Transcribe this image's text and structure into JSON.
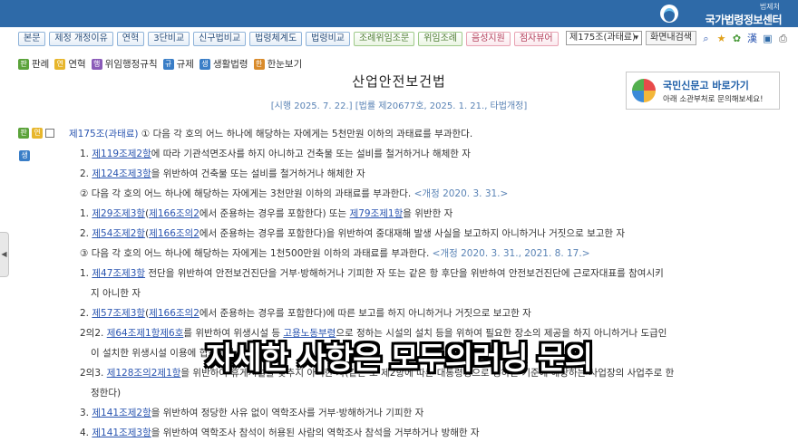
{
  "brand": {
    "org": "법제처",
    "name": "국가법령정보센터"
  },
  "toolbar": [
    {
      "label": "본문",
      "tone": "blue"
    },
    {
      "label": "제정 개정이유",
      "tone": "blue"
    },
    {
      "label": "연혁",
      "tone": "blue"
    },
    {
      "label": "3단비교",
      "tone": "blue"
    },
    {
      "label": "신구법비교",
      "tone": "blue"
    },
    {
      "label": "법령체계도",
      "tone": "blue"
    },
    {
      "label": "법령비교",
      "tone": "blue"
    },
    {
      "label": "조례위임조문",
      "tone": "green"
    },
    {
      "label": "위임조례",
      "tone": "green"
    },
    {
      "label": "음성지원",
      "tone": "pink"
    },
    {
      "label": "점자뷰어",
      "tone": "pink"
    }
  ],
  "tools": {
    "article_select": "제175조(과태료)",
    "wide_view": "화면내검색",
    "icons": [
      "search-icon",
      "bookmark-icon",
      "leaf-icon",
      "translate-icon",
      "save-icon",
      "print-icon"
    ]
  },
  "legend": [
    {
      "tag": "판",
      "label": "판례",
      "color": "#5ba33b"
    },
    {
      "tag": "연",
      "label": "연혁",
      "color": "#e7b62c"
    },
    {
      "tag": "행",
      "label": "위임행정규칙",
      "color": "#8a5ab8"
    },
    {
      "tag": "규",
      "label": "규제",
      "color": "#3a7ec7"
    },
    {
      "tag": "생",
      "label": "생활법령",
      "color": "#3a7ec7"
    },
    {
      "tag": "한",
      "label": "한눈보기",
      "color": "#d98b2b"
    }
  ],
  "law": {
    "title": "산업안전보건법",
    "meta": "[시행 2025. 7. 22.] [법률 제20677호, 2025. 1. 21., 타법개정]"
  },
  "banner": {
    "title": "국민신문고 바로가기",
    "subtitle": "아래 소관부처로 문의해보세요!"
  },
  "side_tags": [
    "판",
    "연"
  ],
  "side_tag_extra": "생",
  "article": {
    "head": "제175조(과태료)",
    "p1": "① 다음 각 호의 어느 하나에 해당하는 자에게는 5천만원 이하의 과태료를 부과한다.",
    "p1_items": [
      {
        "num": "1.",
        "link": "제119조제2항",
        "rest": "에 따라 기관석면조사를 하지 아니하고 건축물 또는 설비를 철거하거나 해체한 자"
      },
      {
        "num": "2.",
        "link": "제124조제3항",
        "rest": "을 위반하여 건축물 또는 설비를 철거하거나 해체한 자"
      }
    ],
    "p2": "② 다음 각 호의 어느 하나에 해당하는 자에게는 3천만원 이하의 과태료를 부과한다.",
    "p2_ref": "<개정 2020. 3. 31.>",
    "p2_items": [
      {
        "num": "1.",
        "link": "제29조제3항",
        "mid": "(",
        "link2": "제166조의2",
        "rest": "에서 준용하는 경우를 포함한다) 또는 ",
        "link3": "제79조제1항",
        "rest2": "을 위반한 자"
      },
      {
        "num": "2.",
        "link": "제54조제2항",
        "mid": "(",
        "link2": "제166조의2",
        "rest": "에서 준용하는 경우를 포함한다)을 위반하여 중대재해 발생 사실을 보고하지 아니하거나 거짓으로 보고한 자",
        "link3": "",
        "rest2": ""
      }
    ],
    "p3": "③ 다음 각 호의 어느 하나에 해당하는 자에게는 1천500만원 이하의 과태료를 부과한다.",
    "p3_ref": "<개정 2020. 3. 31., 2021. 8. 17.>",
    "p3_item1": {
      "num": "1.",
      "link": "제47조제3항",
      "rest": " 전단을 위반하여 안전보건진단을 거부·방해하거나 기피한 자 또는 같은 항 후단을 위반하여 안전보건진단에 근로자대표를 참여시키",
      "cont": "지 아니한 자"
    },
    "p3_item2": {
      "num": "2.",
      "link": "제57조제3항",
      "mid": "(",
      "link2": "제166조의2",
      "rest": "에서 준용하는 경우를 포함한다)에 따른 보고를 하지 아니하거나 거짓으로 보고한 자"
    },
    "p3_item2_2": {
      "num": "2의2.",
      "link": "제64조제1항제6호",
      "rest": "를 위반하여 위생시설 등 ",
      "link2": "고용노동부령",
      "rest2": "으로 정하는 시설의 설치 등을 위하여 필요한 장소의 제공을 하지 아니하거나 도급인",
      "cont": "이 설치한 위생시설 이용에 협조하지 아니한 자"
    },
    "p3_item2_3": {
      "num": "2의3.",
      "link": "제128조의2제1항",
      "rest": "을 위반하여 휴게시설을 갖추지 아니한 자(같은 조 제2항에 따른 대통령령으로 정하는 기준에 해당하는 사업장의 사업주로 한",
      "cont": "정한다)"
    },
    "p3_item3": {
      "num": "3.",
      "link": "제141조제2항",
      "rest": "을 위반하여 정당한 사유 없이 역학조사를 거부·방해하거나 기피한 자"
    },
    "p3_item4": {
      "num": "4.",
      "link": "제141조제3항",
      "rest": "을 위반하여 역학조사 참석이 허용된 사람의 역학조사 참석을 거부하거나 방해한 자"
    }
  },
  "caption": "자세한 사항은 모두의러닝 문의"
}
